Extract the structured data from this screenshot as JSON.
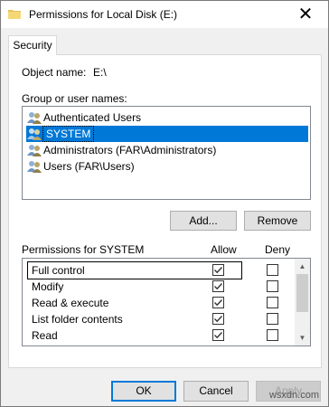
{
  "window": {
    "title": "Permissions for Local Disk (E:)",
    "close_glyph": "✕"
  },
  "tab": {
    "label": "Security"
  },
  "object": {
    "label": "Object name:",
    "value": "E:\\"
  },
  "groups": {
    "label": "Group or user names:",
    "items": [
      {
        "label": "Authenticated Users",
        "selected": false
      },
      {
        "label": "SYSTEM",
        "selected": true
      },
      {
        "label": "Administrators (FAR\\Administrators)",
        "selected": false
      },
      {
        "label": "Users (FAR\\Users)",
        "selected": false
      }
    ]
  },
  "buttons": {
    "add": "Add...",
    "remove": "Remove",
    "ok": "OK",
    "cancel": "Cancel",
    "apply": "Apply"
  },
  "permissions": {
    "header": "Permissions for SYSTEM",
    "allow_label": "Allow",
    "deny_label": "Deny",
    "rows": [
      {
        "name": "Full control",
        "allow": true,
        "deny": false
      },
      {
        "name": "Modify",
        "allow": true,
        "deny": false
      },
      {
        "name": "Read & execute",
        "allow": true,
        "deny": false
      },
      {
        "name": "List folder contents",
        "allow": true,
        "deny": false
      },
      {
        "name": "Read",
        "allow": true,
        "deny": false
      }
    ]
  },
  "watermark": "wsxdn.com",
  "colors": {
    "selection": "#0078d7",
    "window_bg": "#f0f0f0"
  }
}
